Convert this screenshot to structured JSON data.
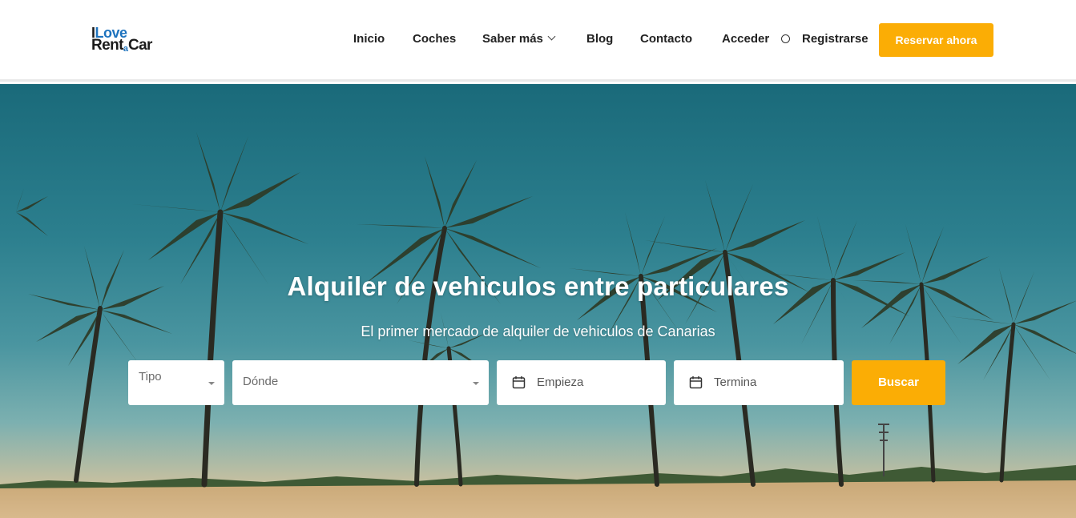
{
  "logo": {
    "line1_i": "I",
    "line1_love": "Love",
    "line2_rent": "Rent",
    "line2_a": "a",
    "line2_car": "Car"
  },
  "nav": {
    "items": [
      {
        "label": "Inicio"
      },
      {
        "label": "Coches"
      },
      {
        "label": "Saber más"
      },
      {
        "label": "Blog"
      },
      {
        "label": "Contacto"
      },
      {
        "label": "Acceder"
      },
      {
        "label": "Registrarse"
      }
    ],
    "cta_label": "Reservar ahora"
  },
  "hero": {
    "title": "Alquiler de vehiculos entre particulares",
    "subtitle": "El primer mercado de alquiler de vehiculos de Canarias"
  },
  "search": {
    "type_placeholder": "Tipo",
    "location_placeholder": "Dónde",
    "start_placeholder": "Empieza",
    "end_placeholder": "Termina",
    "submit_label": "Buscar"
  },
  "colors": {
    "accent": "#fbad05",
    "brand_blue": "#1e73be"
  }
}
